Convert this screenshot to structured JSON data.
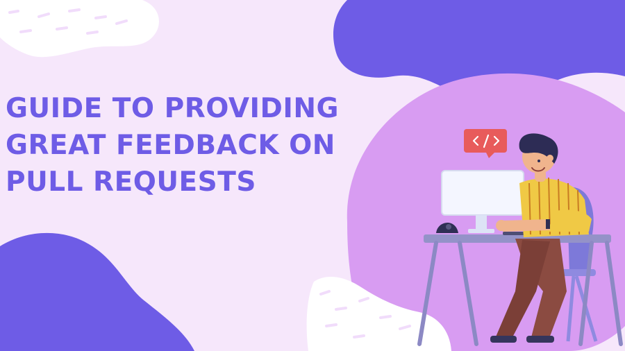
{
  "title": {
    "lines": [
      "GUIDE TO PROVIDING",
      "GREAT FEEDBACK ON",
      "PULL REQUESTS"
    ]
  },
  "colors": {
    "background": "#f6e7fb",
    "accent_blob": "#6e5ce6",
    "main_circle": "#d89cf2",
    "white_blob": "#ffffff",
    "title_text": "#6e5ce6"
  },
  "illustration": {
    "code_bubble_icon": "code-icon",
    "monitor_icon": "monitor-icon",
    "person_icon": "developer-person-icon",
    "desk_icon": "desk-icon"
  }
}
